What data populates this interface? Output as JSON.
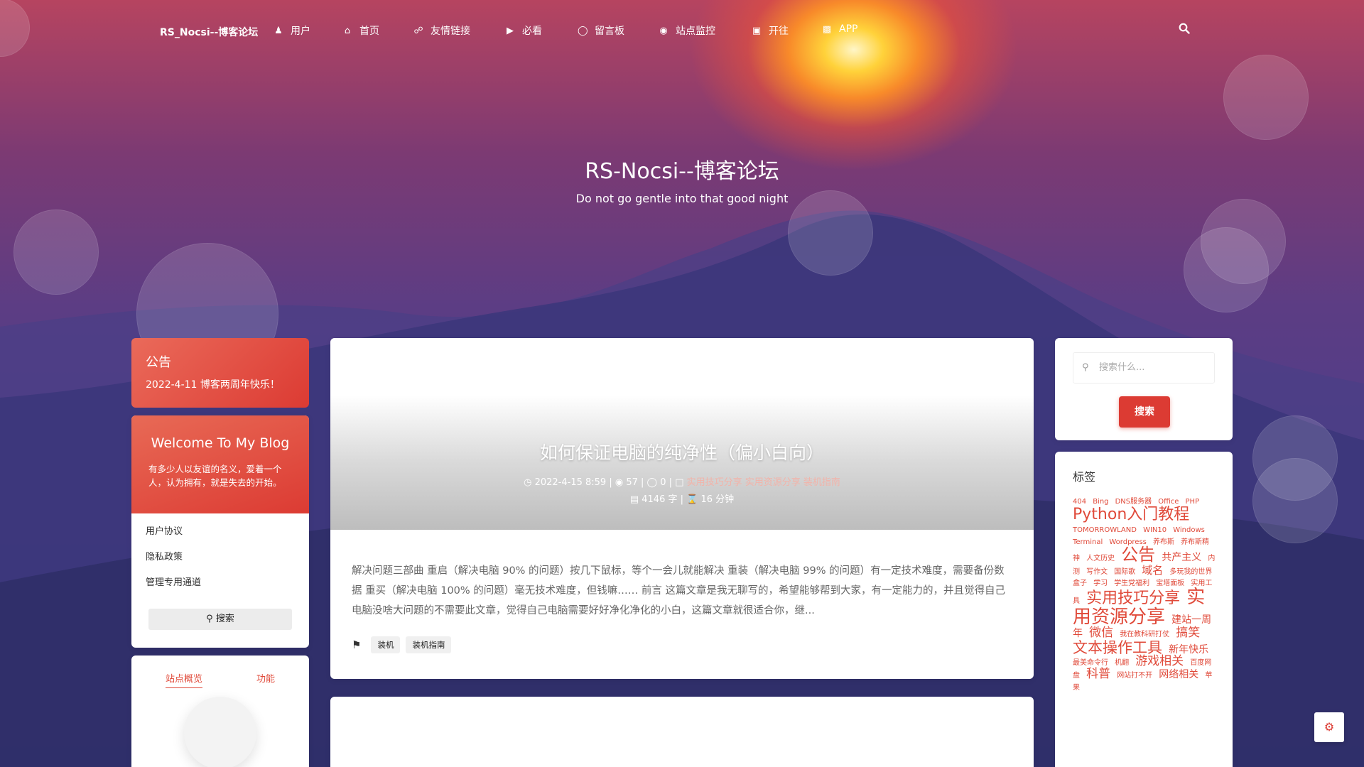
{
  "colors": {
    "accent": "#dc3b33",
    "tag_text": "#e04a3a",
    "text": "#333333"
  },
  "nav": {
    "brand": "RS_Nocsi--博客论坛",
    "items": [
      {
        "icon": "user-icon",
        "label": "用户"
      },
      {
        "icon": "home-icon",
        "label": "首页"
      },
      {
        "icon": "link-icon",
        "label": "友情链接"
      },
      {
        "icon": "megaphone-icon",
        "label": "必看"
      },
      {
        "icon": "comment-icon",
        "label": "留言板"
      },
      {
        "icon": "eye-icon",
        "label": "站点监控"
      },
      {
        "icon": "train-icon",
        "label": "开往"
      },
      {
        "icon": "briefcase-icon",
        "label": "APP"
      }
    ]
  },
  "hero": {
    "title": "RS-Nocsi--博客论坛",
    "subtitle": "Do not go gentle into that good night"
  },
  "notice": {
    "title": "公告",
    "content": "2022-4-11 博客两周年快乐！"
  },
  "welcome": {
    "title": "Welcome To My Blog",
    "text": "有多少人以友谊的名义，爱着一个人，认为拥有，就是失去的开始。",
    "links": [
      "用户协议",
      "隐私政策",
      "管理专用通道"
    ],
    "search_label": "搜索"
  },
  "stats": {
    "tabs": [
      "站点概览",
      "功能"
    ]
  },
  "post": {
    "title": "如何保证电脑的纯净性（偏小白向）",
    "date": "2022-4-15 8:59",
    "views": "57",
    "comments": "0",
    "categories": "实用技巧分享 实用资源分享 装机指南",
    "words": "4146 字",
    "read_time": "16 分钟",
    "excerpt": "解决问题三部曲 重启（解决电脑 90% 的问题）按几下鼠标，等个一会儿就能解决 重装（解决电脑 99% 的问题）有一定技术难度，需要备份数据 重买（解决电脑 100% 的问题）毫无技术难度，但钱嘛…… 前言 这篇文章是我无聊写的，希望能够帮到大家，有一定能力的，并且觉得自己电脑没啥大问题的不需要此文章，觉得自己电脑需要好好净化净化的小白，这篇文章就很适合你，继...",
    "tags": [
      "装机",
      "装机指南"
    ]
  },
  "sidebar": {
    "search_placeholder": "搜索什么...",
    "search_button": "搜索",
    "tags_title": "标签",
    "tags": [
      {
        "name": "404",
        "size": 10
      },
      {
        "name": "Bing",
        "size": 10
      },
      {
        "name": "DNS服务器",
        "size": 10
      },
      {
        "name": "Office",
        "size": 10
      },
      {
        "name": "PHP",
        "size": 10
      },
      {
        "name": "Python入门教程",
        "size": 22
      },
      {
        "name": "TOMORROWLAND",
        "size": 10
      },
      {
        "name": "WIN10",
        "size": 10
      },
      {
        "name": "Windows",
        "size": 10
      },
      {
        "name": "Terminal",
        "size": 10
      },
      {
        "name": "Wordpress",
        "size": 10
      },
      {
        "name": "养布斯",
        "size": 10
      },
      {
        "name": "养布斯精神",
        "size": 10
      },
      {
        "name": "人文历史",
        "size": 10
      },
      {
        "name": "公告",
        "size": 24
      },
      {
        "name": "共产主义",
        "size": 14
      },
      {
        "name": "内测",
        "size": 10
      },
      {
        "name": "写作文",
        "size": 10
      },
      {
        "name": "国际歌",
        "size": 10
      },
      {
        "name": "域名",
        "size": 15
      },
      {
        "name": "多玩我的世界盒子",
        "size": 10
      },
      {
        "name": "学习",
        "size": 10
      },
      {
        "name": "学生党福利",
        "size": 10
      },
      {
        "name": "宝塔面板",
        "size": 10
      },
      {
        "name": "实用工具",
        "size": 10
      },
      {
        "name": "实用技巧分享",
        "size": 22
      },
      {
        "name": "实用资源分享",
        "size": 26
      },
      {
        "name": "建站一周年",
        "size": 14
      },
      {
        "name": "微信",
        "size": 17
      },
      {
        "name": "我在教科研打仗",
        "size": 10
      },
      {
        "name": "搞笑",
        "size": 17
      },
      {
        "name": "文本操作工具",
        "size": 21
      },
      {
        "name": "新年快乐",
        "size": 14
      },
      {
        "name": "最美命令行",
        "size": 10
      },
      {
        "name": "机翻",
        "size": 10
      },
      {
        "name": "游戏相关",
        "size": 17
      },
      {
        "name": "百度网盘",
        "size": 10
      },
      {
        "name": "科普",
        "size": 17
      },
      {
        "name": "网站打不开",
        "size": 10
      },
      {
        "name": "网络相关",
        "size": 14
      },
      {
        "name": "苹果",
        "size": 10
      }
    ]
  }
}
